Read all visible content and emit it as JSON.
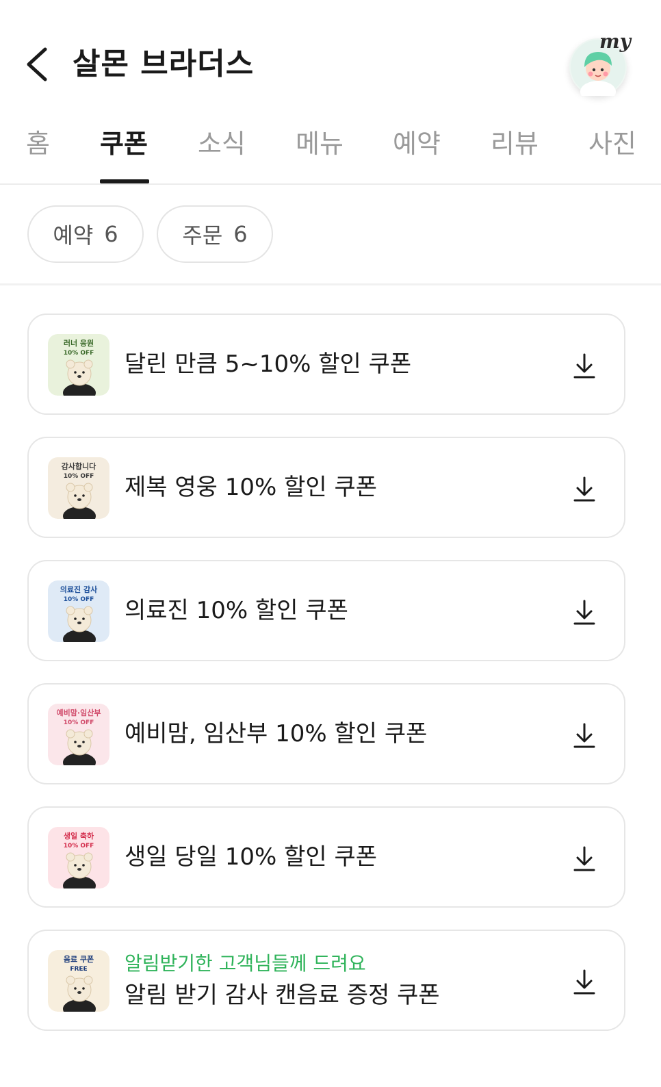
{
  "header": {
    "back_icon": "chevron-left-icon",
    "title": "살몬 브라더스",
    "my_label": "my"
  },
  "tabs": [
    {
      "label": "홈",
      "active": false
    },
    {
      "label": "쿠폰",
      "active": true
    },
    {
      "label": "소식",
      "active": false
    },
    {
      "label": "메뉴",
      "active": false
    },
    {
      "label": "예약",
      "active": false
    },
    {
      "label": "리뷰",
      "active": false
    },
    {
      "label": "사진",
      "active": false
    }
  ],
  "filters": [
    {
      "label": "예약",
      "count": "6"
    },
    {
      "label": "주문",
      "count": "6"
    }
  ],
  "coupons": [
    {
      "title": "달린 만큼 5~10% 할인 쿠폰",
      "thumb": {
        "line1": "러너 응원",
        "line2": "10% OFF",
        "bg": "#e9f2dc",
        "accent": "#3c6b2b"
      }
    },
    {
      "title": "제복 영웅 10% 할인 쿠폰",
      "thumb": {
        "line1": "감사합니다",
        "line2": "10% OFF",
        "bg": "#f4ecdf",
        "accent": "#3a3a3a"
      }
    },
    {
      "title": "의료진 10% 할인 쿠폰",
      "thumb": {
        "line1": "의료진 감사",
        "line2": "10% OFF",
        "bg": "#dfeaf6",
        "accent": "#1d4f9a"
      }
    },
    {
      "title": "예비맘, 임산부 10% 할인 쿠폰",
      "thumb": {
        "line1": "예비맘·임산부",
        "line2": "10% OFF",
        "bg": "#fbe6ea",
        "accent": "#d04a6a"
      }
    },
    {
      "title": "생일 당일 10% 할인 쿠폰",
      "thumb": {
        "line1": "생일 축하",
        "line2": "10% OFF",
        "bg": "#fde3e7",
        "accent": "#d4304e"
      }
    },
    {
      "subtitle": "알림받기한 고객님들께 드려요",
      "title": "알림 받기 감사 캔음료 증정 쿠폰",
      "thumb": {
        "line1": "음료 쿠폰",
        "line2": "FREE",
        "bg": "#f7eedd",
        "accent": "#1a3a7a"
      }
    }
  ],
  "icons": {
    "download": "download-icon",
    "avatar": "avatar"
  }
}
